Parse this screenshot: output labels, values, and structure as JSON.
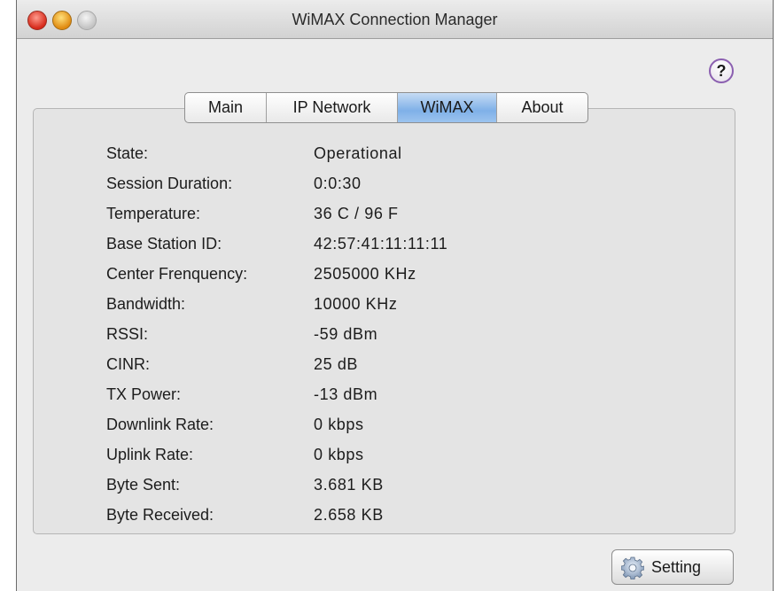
{
  "window": {
    "title": "WiMAX Connection Manager"
  },
  "help": {
    "label": "?"
  },
  "tabs": [
    {
      "label": "Main"
    },
    {
      "label": "IP Network"
    },
    {
      "label": "WiMAX",
      "active": true
    },
    {
      "label": "About"
    }
  ],
  "rows": [
    {
      "label": "State:",
      "value": "Operational"
    },
    {
      "label": "Session Duration:",
      "value": "0:0:30"
    },
    {
      "label": "Temperature:",
      "value": "36 C / 96 F"
    },
    {
      "label": "Base Station ID:",
      "value": "42:57:41:11:11:11"
    },
    {
      "label": "Center Frenquency:",
      "value": "2505000 KHz"
    },
    {
      "label": "Bandwidth:",
      "value": "10000 KHz"
    },
    {
      "label": "RSSI:",
      "value": "-59 dBm"
    },
    {
      "label": "CINR:",
      "value": "25 dB"
    },
    {
      "label": "TX Power:",
      "value": "-13 dBm"
    },
    {
      "label": "Downlink Rate:",
      "value": "0 kbps"
    },
    {
      "label": "Uplink Rate:",
      "value": "0 kbps"
    },
    {
      "label": "Byte Sent:",
      "value": "3.681 KB"
    },
    {
      "label": "Byte Received:",
      "value": "2.658 KB"
    }
  ],
  "setting_button": {
    "label": "Setting",
    "icon": "gear-icon"
  },
  "colors": {
    "active_tab": "#7fb0e8",
    "help_ring": "#8b5fb0",
    "close_light": "#d6291a",
    "minimize_light": "#e08a10"
  }
}
